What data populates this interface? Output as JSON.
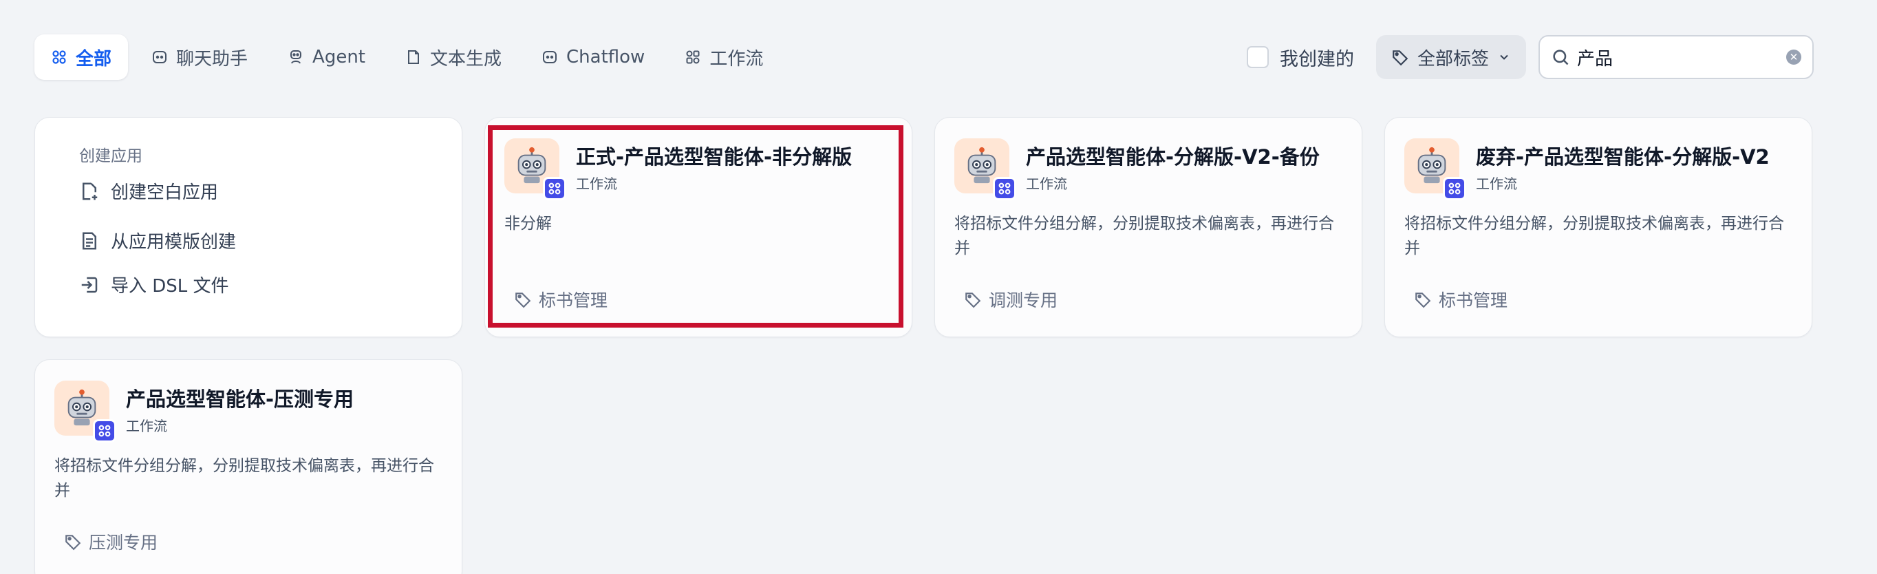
{
  "tabs": [
    {
      "label": "全部",
      "icon": "grid-icon",
      "active": true
    },
    {
      "label": "聊天助手",
      "icon": "chat-bot-icon"
    },
    {
      "label": "Agent",
      "icon": "agent-icon"
    },
    {
      "label": "文本生成",
      "icon": "document-icon"
    },
    {
      "label": "Chatflow",
      "icon": "chatflow-icon"
    },
    {
      "label": "工作流",
      "icon": "workflow-icon"
    }
  ],
  "filters": {
    "mine_label": "我创建的",
    "mine_checked": false,
    "tag_filter_label": "全部标签",
    "search_value": "产品"
  },
  "create": {
    "title": "创建应用",
    "items": [
      {
        "label": "创建空白应用",
        "icon": "file-plus-icon"
      },
      {
        "label": "从应用模版创建",
        "icon": "template-icon"
      },
      {
        "label": "导入 DSL 文件",
        "icon": "import-icon"
      }
    ]
  },
  "apps": [
    {
      "name": "正式-产品选型智能体-非分解版",
      "mode": "工作流",
      "description": "非分解",
      "tag": "标书管理",
      "highlighted": true
    },
    {
      "name": "产品选型智能体-分解版-V2-备份",
      "mode": "工作流",
      "description": "将招标文件分组分解，分别提取技术偏离表，再进行合并",
      "tag": "调测专用"
    },
    {
      "name": "废弃-产品选型智能体-分解版-V2",
      "mode": "工作流",
      "description": "将招标文件分组分解，分别提取技术偏离表，再进行合并",
      "tag": "标书管理"
    },
    {
      "name": "产品选型智能体-压测专用",
      "mode": "工作流",
      "description": "将招标文件分组分解，分别提取技术偏离表，再进行合并",
      "tag": "压测专用"
    }
  ],
  "colors": {
    "accent": "#155eef",
    "badge": "#444ce7",
    "icon_bg": "#ffe6d5",
    "highlight": "#c8102e"
  }
}
